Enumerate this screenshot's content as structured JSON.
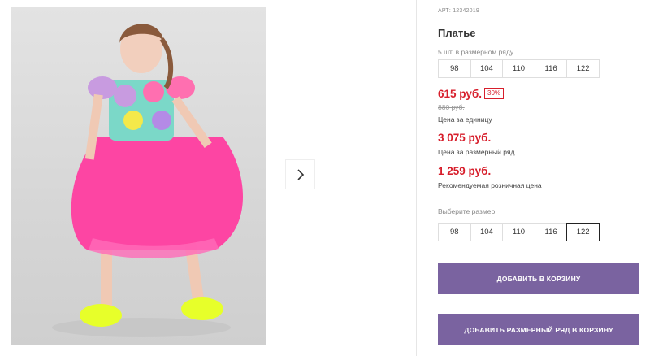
{
  "product": {
    "sku": "АРТ: 12342019",
    "title": "Платье",
    "set_note": "5 шт. в размерном ряду",
    "size_row_sizes": [
      "98",
      "104",
      "110",
      "116",
      "122"
    ],
    "price": "615 руб.",
    "discount": "30%",
    "old_price": "880 руб.",
    "unit_price_label": "Цена за единицу",
    "set_price": "3 075 руб.",
    "set_price_label": "Цена за размерный ряд",
    "rrp_price": "1 259 руб.",
    "rrp_label": "Рекомендуемая розничная цена",
    "choose_size_label": "Выберите размер:",
    "size_options": [
      "98",
      "104",
      "110",
      "116",
      "122"
    ],
    "selected_size": "122"
  },
  "buttons": {
    "add_to_cart": "ДОБАВИТЬ В КОРЗИНУ",
    "add_set_to_cart": "ДОБАВИТЬ РАЗМЕРНЫЙ РЯД В КОРЗИНУ"
  },
  "colors": {
    "accent": "#7a63a0",
    "price": "#d71f2c"
  },
  "icons": {
    "next": "chevron-right-icon"
  }
}
